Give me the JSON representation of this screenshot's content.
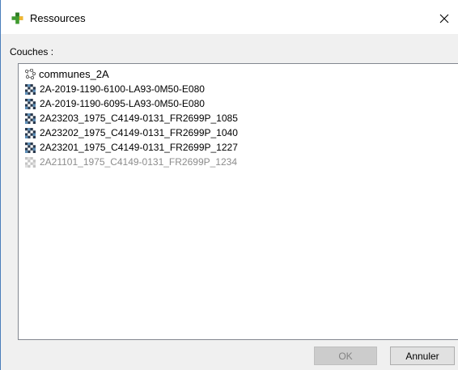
{
  "window": {
    "title": "Ressources",
    "icon": "qgis-plus-icon",
    "close_icon": "close-icon"
  },
  "section": {
    "label": "Couches :"
  },
  "layers": [
    {
      "name": "communes_2A",
      "type": "vector",
      "icon": "vector-layer-icon",
      "enabled": true
    },
    {
      "name": "2A-2019-1190-6100-LA93-0M50-E080",
      "type": "raster",
      "icon": "raster-layer-icon",
      "enabled": true
    },
    {
      "name": "2A-2019-1190-6095-LA93-0M50-E080",
      "type": "raster",
      "icon": "raster-layer-icon",
      "enabled": true
    },
    {
      "name": "2A23203_1975_C4149-0131_FR2699P_1085",
      "type": "raster",
      "icon": "raster-layer-icon",
      "enabled": true
    },
    {
      "name": "2A23202_1975_C4149-0131_FR2699P_1040",
      "type": "raster",
      "icon": "raster-layer-icon",
      "enabled": true
    },
    {
      "name": "2A23201_1975_C4149-0131_FR2699P_1227",
      "type": "raster",
      "icon": "raster-layer-icon",
      "enabled": true
    },
    {
      "name": "2A21101_1975_C4149-0131_FR2699P_1234",
      "type": "raster",
      "icon": "raster-layer-icon",
      "enabled": false
    }
  ],
  "buttons": {
    "ok_label": "OK",
    "cancel_label": "Annuler"
  },
  "colors": {
    "accent": "#4a7ebb",
    "qgis_green": "#3f9a2f",
    "disabled_text": "#8c8c8c"
  }
}
